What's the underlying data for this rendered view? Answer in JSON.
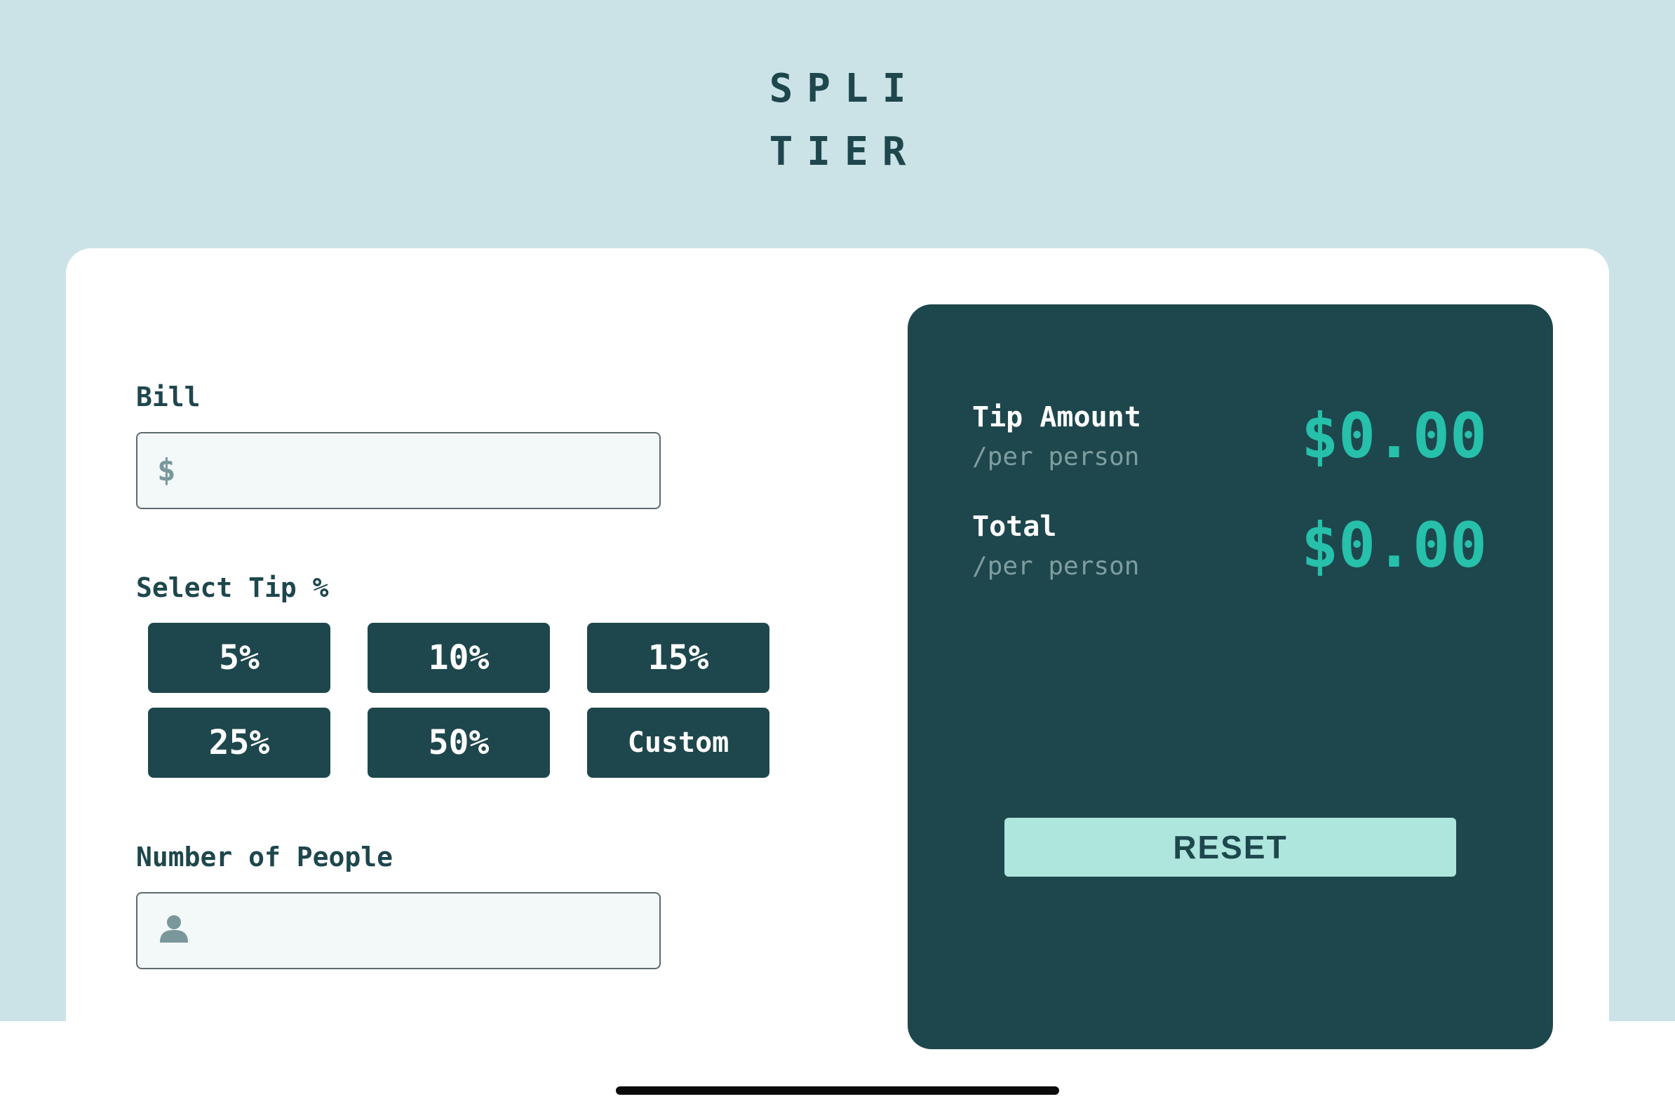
{
  "app": {
    "logo_line1": "SPLI",
    "logo_line2": "TIER"
  },
  "form": {
    "bill": {
      "label": "Bill",
      "icon": "dollar-icon",
      "icon_glyph": "$",
      "value": "",
      "placeholder": ""
    },
    "tip": {
      "label": "Select Tip %",
      "options": [
        "5%",
        "10%",
        "15%",
        "25%",
        "50%"
      ],
      "custom_label": "Custom"
    },
    "people": {
      "label": "Number of People",
      "icon": "person-icon",
      "value": "",
      "placeholder": ""
    }
  },
  "results": {
    "tip_amount": {
      "title": "Tip Amount",
      "subtitle": "/per person",
      "value": "$0.00"
    },
    "total": {
      "title": "Total",
      "subtitle": "/per person",
      "value": "$0.00"
    },
    "reset_label": "RESET"
  },
  "colors": {
    "background": "#cbe3e7",
    "dark_cyan": "#1e474d",
    "accent": "#26c0ab",
    "reset_bg": "#aee5dd",
    "input_bg": "#f3f8f9"
  }
}
